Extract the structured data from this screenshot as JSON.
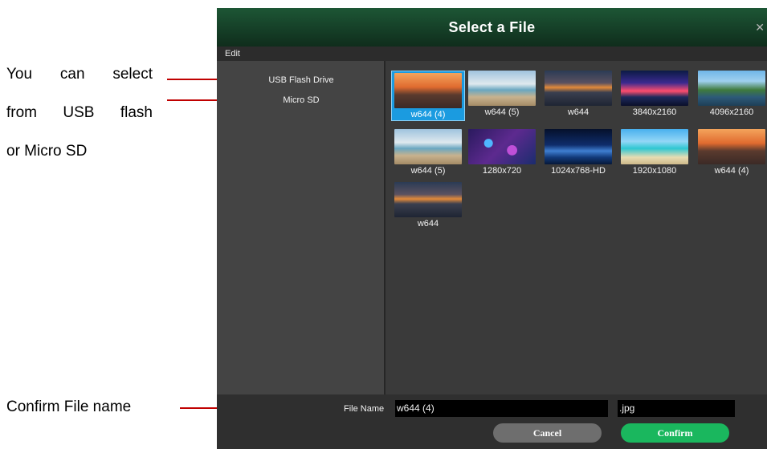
{
  "annotations": {
    "line1_words": [
      "You",
      "can",
      "select"
    ],
    "line2_words": [
      "from",
      "USB",
      "flash"
    ],
    "line3": "or Micro SD",
    "confirm_note": "Confirm File name",
    "arrow_color": "#c00000"
  },
  "dialog": {
    "title": "Select a File",
    "close_icon": "close-icon",
    "menu": [
      "Edit"
    ],
    "sources": [
      "USB Flash Drive",
      "Micro SD"
    ],
    "files": [
      {
        "caption": "w644 (4)",
        "selected": true,
        "thumb": "sunset-pier"
      },
      {
        "caption": "w644 (5)",
        "selected": false,
        "thumb": "beach-waves"
      },
      {
        "caption": "w644",
        "selected": false,
        "thumb": "sunset-sea"
      },
      {
        "caption": "3840x2160",
        "selected": false,
        "thumb": "city-night"
      },
      {
        "caption": "4096x2160",
        "selected": false,
        "thumb": "mountain-coast"
      },
      {
        "caption": "w644 (5)",
        "selected": false,
        "thumb": "beach-waves"
      },
      {
        "caption": "1280x720",
        "selected": false,
        "thumb": "purple-cubes"
      },
      {
        "caption": "1024x768-HD",
        "selected": false,
        "thumb": "clouds-night"
      },
      {
        "caption": "1920x1080",
        "selected": false,
        "thumb": "tropical-beach"
      },
      {
        "caption": "w644 (4)",
        "selected": false,
        "thumb": "sunset-pier"
      },
      {
        "caption": "w644",
        "selected": false,
        "thumb": "sunset-sea"
      }
    ],
    "file_name_label": "File Name",
    "file_name_value": "w644 (4)",
    "extension_value": ".jpg",
    "cancel_label": "Cancel",
    "confirm_label": "Confirm",
    "colors": {
      "title_bar": "#1d5635",
      "selection": "#1b9be0",
      "confirm": "#1ab75e",
      "cancel": "#6e6e6e"
    }
  }
}
